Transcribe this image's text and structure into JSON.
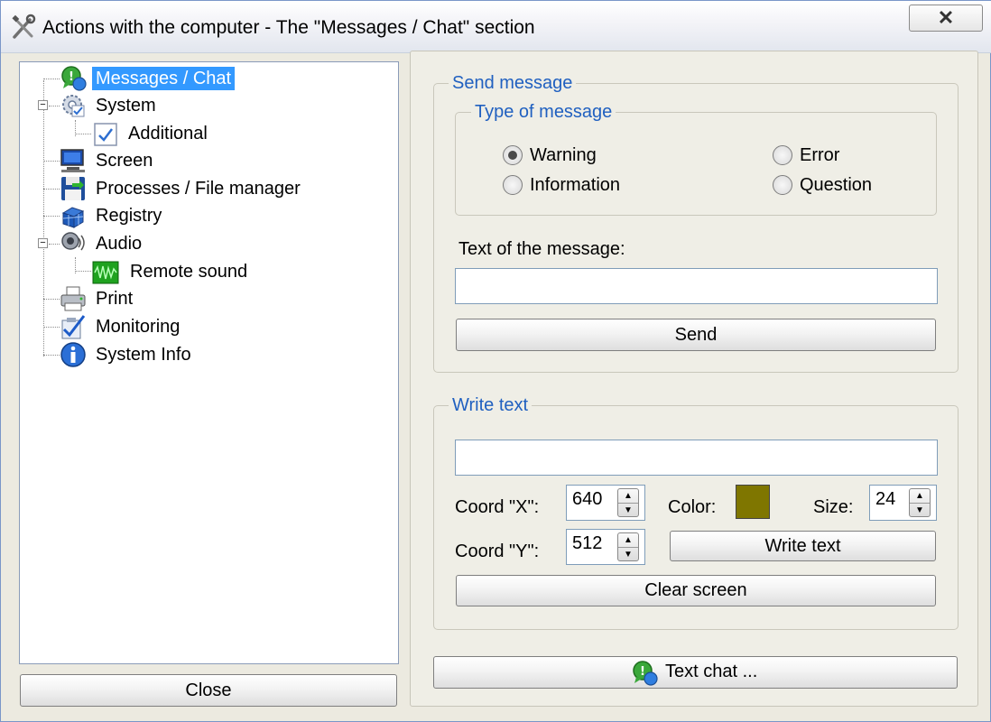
{
  "window": {
    "title": "Actions with the computer - The \"Messages / Chat\" section",
    "close_glyph": "✕"
  },
  "tree": {
    "items": [
      {
        "label": "Messages / Chat",
        "icon": "chat-icon",
        "selected": true
      },
      {
        "label": "System",
        "icon": "gear-icon",
        "expander": "−"
      },
      {
        "label": "Additional",
        "icon": "checkbox-icon"
      },
      {
        "label": "Screen",
        "icon": "monitor-icon"
      },
      {
        "label": "Processes / File manager",
        "icon": "floppy-icon"
      },
      {
        "label": "Registry",
        "icon": "registry-icon"
      },
      {
        "label": "Audio",
        "icon": "speaker-icon",
        "expander": "−"
      },
      {
        "label": "Remote sound",
        "icon": "waveform-icon"
      },
      {
        "label": "Print",
        "icon": "printer-icon"
      },
      {
        "label": "Monitoring",
        "icon": "monitoring-icon"
      },
      {
        "label": "System Info",
        "icon": "info-icon"
      }
    ]
  },
  "footer": {
    "close_label": "Close",
    "text_chat_label": "Text chat ..."
  },
  "send_message": {
    "legend": "Send message",
    "type_legend": "Type of message",
    "options": [
      {
        "label": "Warning",
        "checked": true
      },
      {
        "label": "Error",
        "checked": false
      },
      {
        "label": "Information",
        "checked": false
      },
      {
        "label": "Question",
        "checked": false
      }
    ],
    "text_label": "Text of the message:",
    "text_value": "",
    "send_label": "Send"
  },
  "write_text": {
    "legend": "Write text",
    "text_value": "",
    "coord_x_label": "Coord \"X\":",
    "coord_x_value": "640",
    "coord_y_label": "Coord \"Y\":",
    "coord_y_value": "512",
    "color_label": "Color:",
    "color_value": "#7f7600",
    "size_label": "Size:",
    "size_value": "24",
    "write_label": "Write text",
    "clear_label": "Clear screen"
  }
}
